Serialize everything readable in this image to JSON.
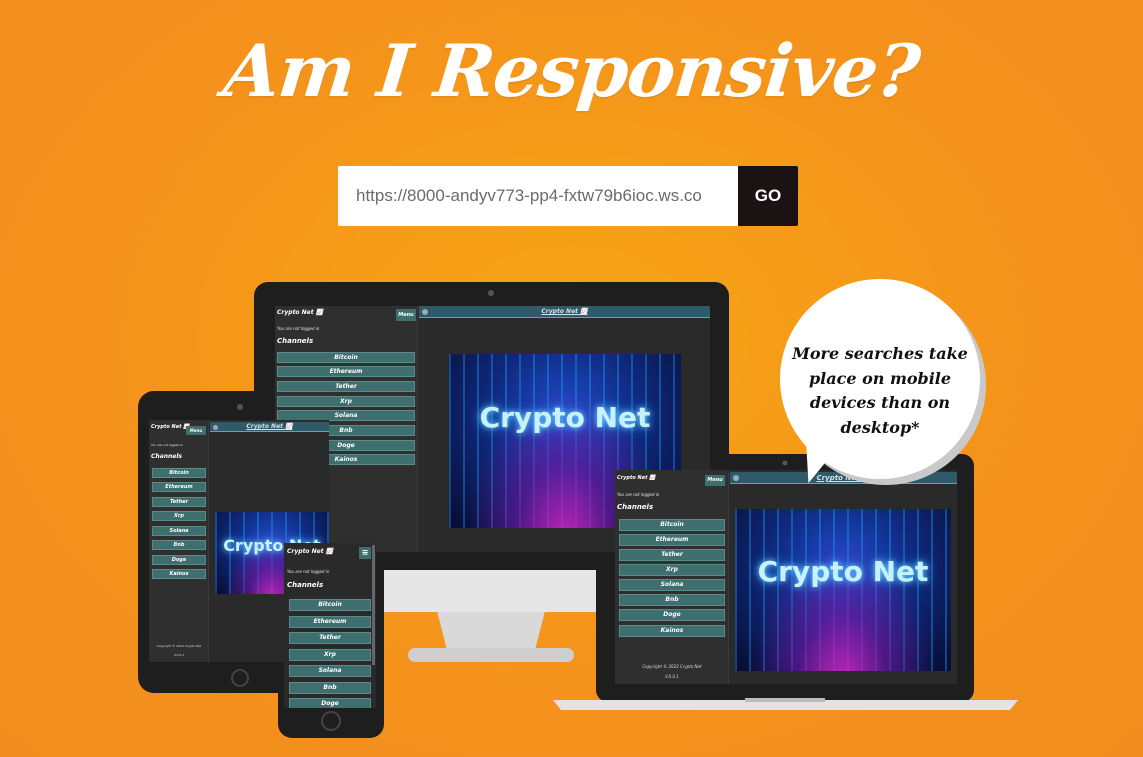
{
  "page": {
    "title": "Am I Responsive?",
    "url_input": {
      "value": "https://8000-andyv773-pp4-fxtw79b6ioc.ws.co",
      "placeholder": ""
    },
    "go_label": "GO",
    "bubble_text": "More searches take place on mobile devices than on desktop*"
  },
  "app": {
    "brand": "Crypto Net 📈",
    "menu_label": "Menu",
    "menu_icon": "hamburger-icon",
    "login_note": "You are not logged in",
    "channels_heading": "Channels",
    "channels": [
      "Bitcoin",
      "Ethereum",
      "Tether",
      "Xrp",
      "Solana",
      "Bnb",
      "Doge",
      "Kainos"
    ],
    "header_title": "Crypto Net 📈",
    "hero_text": "Crypto Net",
    "footer_copyright": "Copyright © 2022 Crypto Net",
    "footer_version": "V.0.0.1"
  },
  "colors": {
    "background": "#f4921c",
    "go_button": "#1b1214",
    "channel_button": "#3f6e6e",
    "header_bar": "#2f5a6a"
  }
}
